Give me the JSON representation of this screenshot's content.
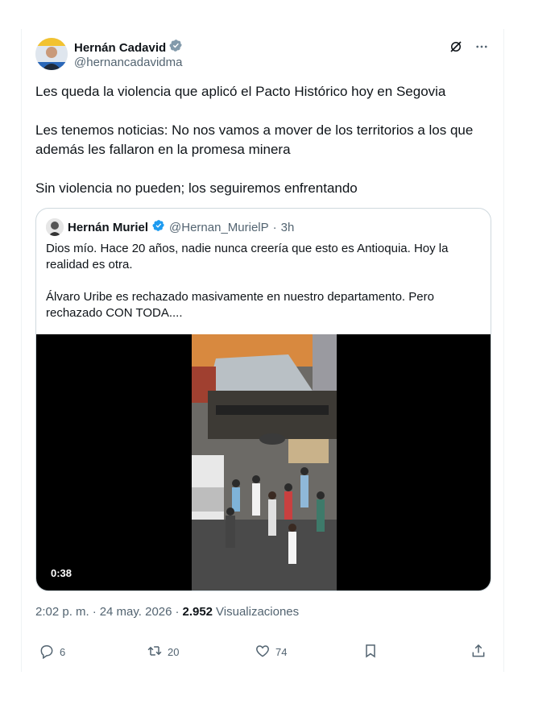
{
  "author": {
    "name": "Hernán Cadavid",
    "handle": "@hernancadavidma",
    "verified_color": "#829aab"
  },
  "tweet_text": [
    "Les queda la violencia que aplicó el Pacto Histórico hoy en Segovia",
    "Les tenemos noticias: No nos vamos a mover de los territorios a los que además les fallaron en la promesa minera",
    "Sin violencia no pueden; los seguiremos enfrentando"
  ],
  "quote": {
    "name": "Hernán Muriel",
    "handle": "@Hernan_MurielP",
    "separator": "·",
    "time": "3h",
    "verified_color": "#1d9bf0",
    "text": [
      "Dios mío. Hace 20 años, nadie nunca creería que esto es Antioquia. Hoy la realidad es otra.",
      "Álvaro Uribe es rechazado masivamente en nuestro departamento. Pero rechazado CON TODA...."
    ],
    "video_duration": "0:38"
  },
  "meta": {
    "time": "2:02 p. m.",
    "separator": "·",
    "date": "24 may. 2026",
    "separator2": "·",
    "views_count": "2.952",
    "views_label": "Visualizaciones"
  },
  "actions": {
    "replies": "6",
    "retweets": "20",
    "likes": "74"
  },
  "icons": [
    "verified-badge-icon",
    "grok-icon",
    "more-icon",
    "reply-icon",
    "retweet-icon",
    "like-icon",
    "bookmark-icon",
    "share-icon"
  ]
}
